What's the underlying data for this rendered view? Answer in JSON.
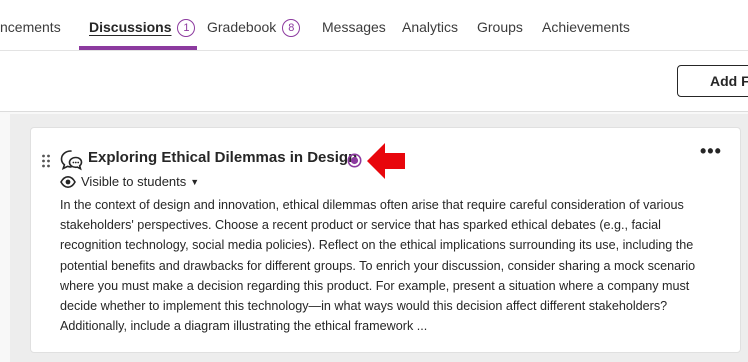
{
  "nav": {
    "tabs": [
      {
        "label": "ncements"
      },
      {
        "label": "Discussions",
        "badge": "1",
        "active": true
      },
      {
        "label": "Gradebook",
        "badge": "8"
      },
      {
        "label": "Messages"
      },
      {
        "label": "Analytics"
      },
      {
        "label": "Groups"
      },
      {
        "label": "Achievements"
      }
    ]
  },
  "toolbar": {
    "add_button_label": "Add Fo"
  },
  "discussion": {
    "title": "Exploring Ethical Dilemmas in Design",
    "visibility": "Visible to students",
    "more_label": "•••",
    "body": "In the context of design and innovation, ethical dilemmas often arise that require careful consideration of various stakeholders' perspectives. Choose a recent product or service that has sparked ethical debates (e.g., facial recognition technology, social media policies). Reflect on the ethical implications surrounding its use, including the potential benefits and drawbacks for different groups. To enrich your discussion, consider sharing a mock scenario where you must make a decision regarding this product. For example, present a situation where a company must decide whether to implement this technology—in what ways would this decision affect different stakeholders? Additionally, include a diagram illustrating the ethical framework ...",
    "icons": {
      "drag": "drag-handle-icon",
      "topic": "discussion-bubble-icon",
      "unread": "unread-indicator-icon",
      "visibility": "eye-icon",
      "annotation": "red-arrow-icon"
    }
  },
  "colors": {
    "accent": "#8c3a9f",
    "arrow": "#e8060c",
    "text": "#262626"
  }
}
